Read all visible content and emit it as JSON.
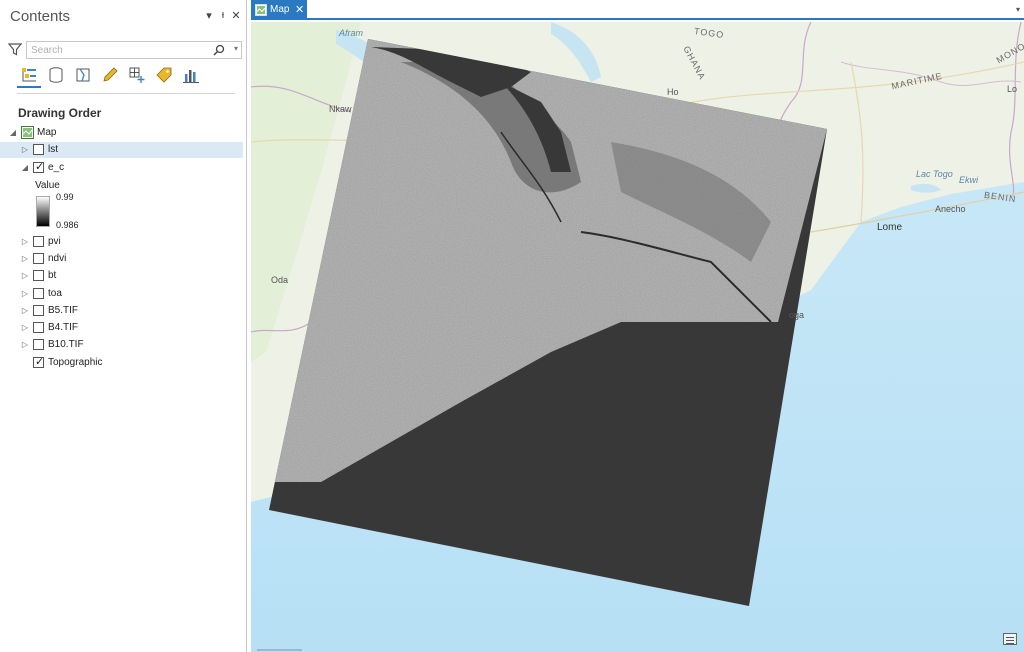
{
  "contents": {
    "title": "Contents",
    "header_controls": {
      "menu": "▾",
      "pin": "ᵻ",
      "close": "✕"
    },
    "search_placeholder": "Search",
    "toolbar_icons": [
      "list-by-drawing-order-icon",
      "list-by-data-source-icon",
      "list-by-selection-icon",
      "list-by-editing-icon",
      "list-by-snapping-icon",
      "list-by-labeling-icon",
      "list-by-charts-icon"
    ],
    "drawing_order_label": "Drawing Order",
    "map_label": "Map",
    "layers": [
      {
        "name": "lst",
        "checked": false,
        "selected": true,
        "expanded": false
      },
      {
        "name": "e_c",
        "checked": true,
        "selected": false,
        "expanded": true
      },
      {
        "name": "pvi",
        "checked": false,
        "selected": false,
        "expanded": false
      },
      {
        "name": "ndvi",
        "checked": false,
        "selected": false,
        "expanded": false
      },
      {
        "name": "bt",
        "checked": false,
        "selected": false,
        "expanded": false
      },
      {
        "name": "toa",
        "checked": false,
        "selected": false,
        "expanded": false
      },
      {
        "name": "B5.TIF",
        "checked": false,
        "selected": false,
        "expanded": false
      },
      {
        "name": "B4.TIF",
        "checked": false,
        "selected": false,
        "expanded": false
      },
      {
        "name": "B10.TIF",
        "checked": false,
        "selected": false,
        "expanded": false
      },
      {
        "name": "Topographic",
        "checked": true,
        "selected": false,
        "expanded": null
      }
    ],
    "legend": {
      "title": "Value",
      "high": "0.99",
      "low": "0.986"
    }
  },
  "map_view": {
    "tab_label": "Map",
    "tab_close": "✕",
    "tab_menu": "▾",
    "labels": {
      "togo": "TOGO",
      "ghana": "GHANA",
      "benin": "BENIN",
      "lome": "Lome",
      "aneho": "Anecho",
      "ho": "Ho",
      "nkawkaw": "Nkaw",
      "oda": "Oda",
      "lac_togo": "Lac Togo",
      "ekwi": "Ekwi",
      "afram": "Afram",
      "maritime": "MARITIME",
      "ada": "oga",
      "mono": "MONO",
      "lokossa": "Lo"
    }
  },
  "colors": {
    "accent": "#2b79c2",
    "selection": "#dbe9f5",
    "ocean": "#bfe3f6",
    "land": "#eef1e6",
    "raster_dark": "#383838"
  }
}
